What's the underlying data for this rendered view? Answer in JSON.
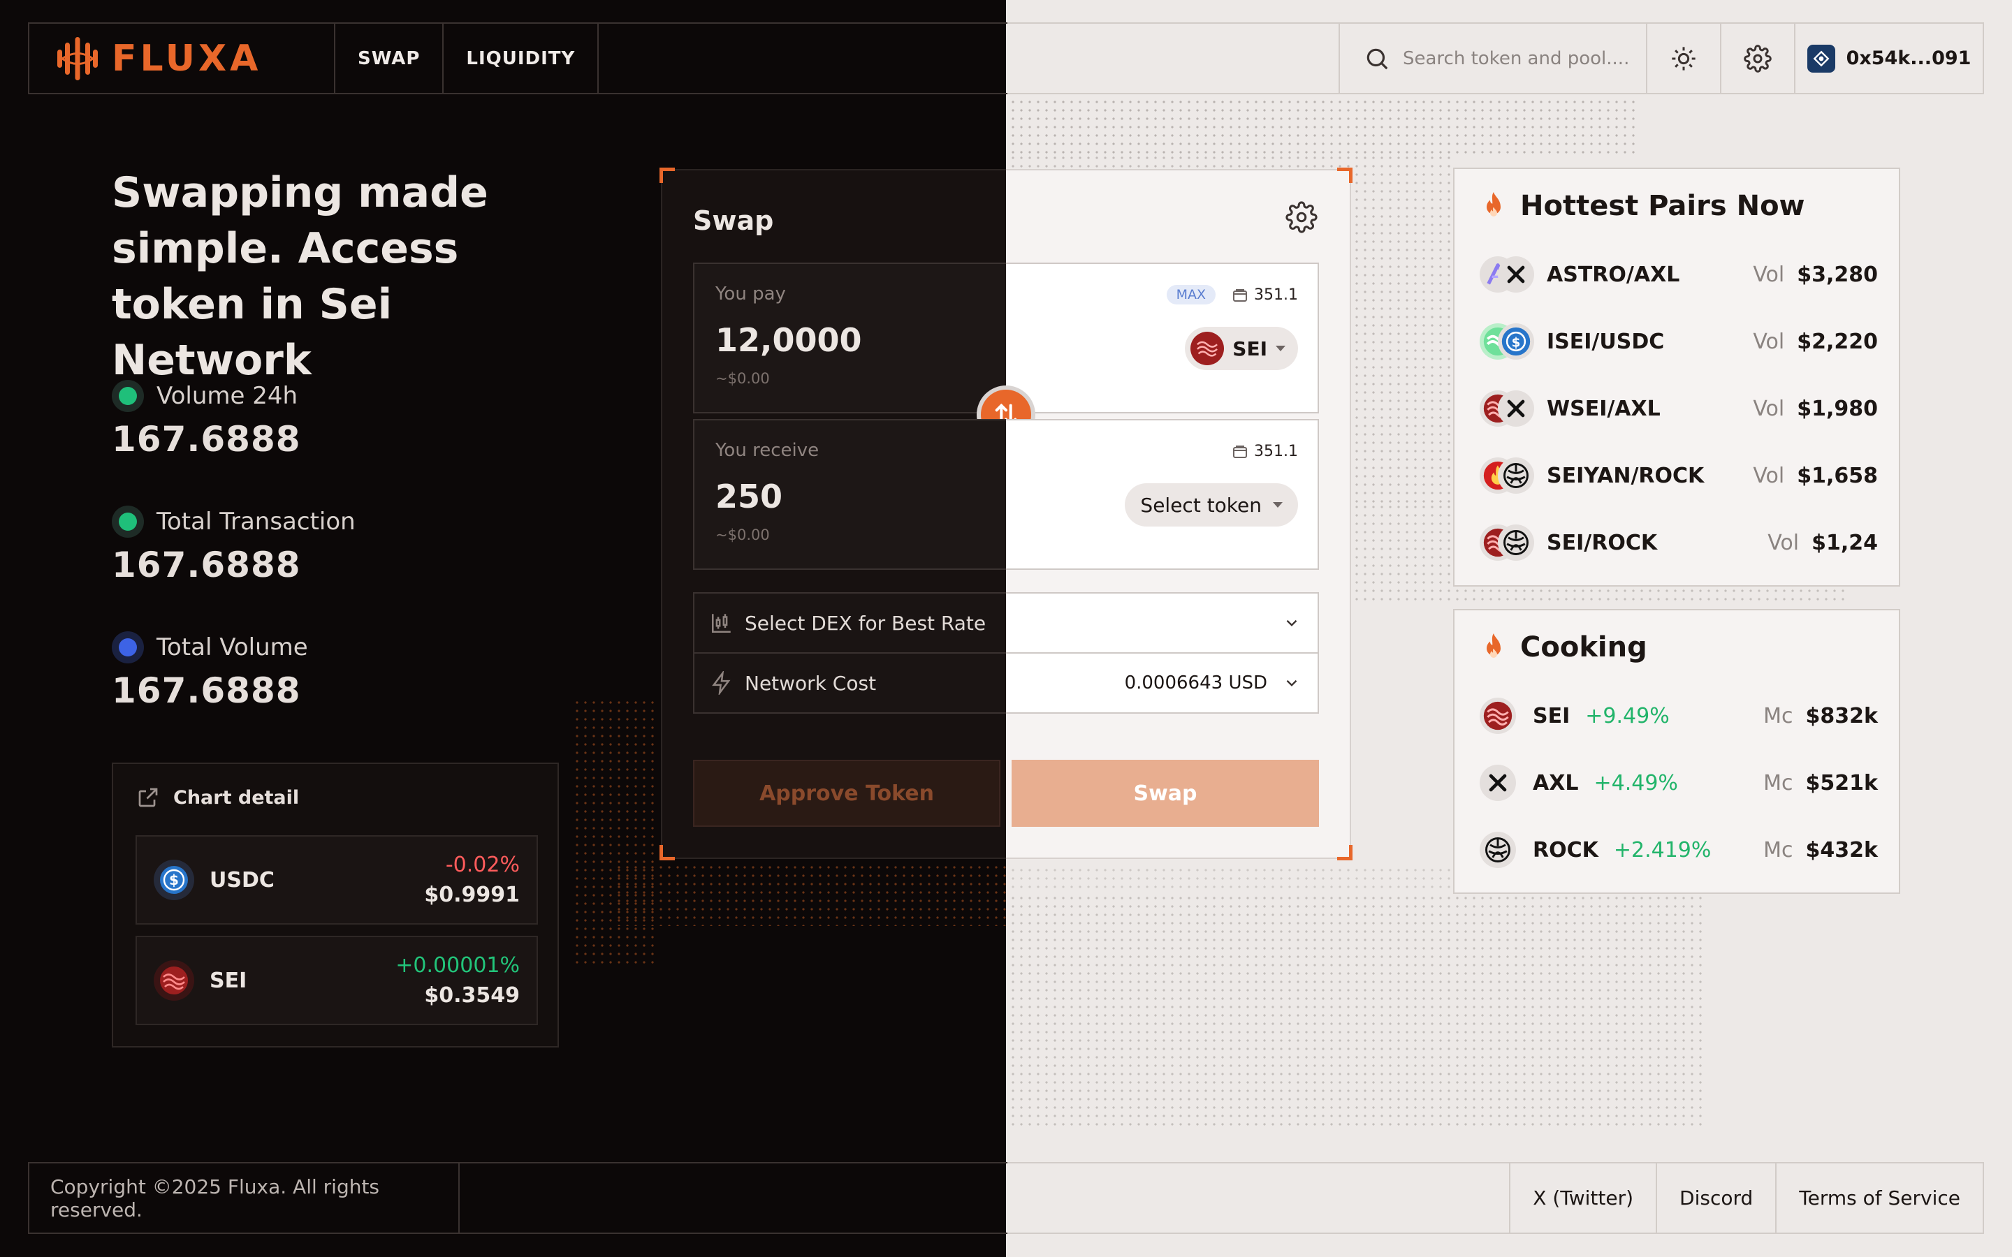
{
  "header": {
    "logo_text": "FLUXA",
    "nav": [
      "SWAP",
      "LIQUIDITY"
    ],
    "search_placeholder": "Search token and pool....",
    "wallet_address": "0x54k...091"
  },
  "hero": {
    "title": "Swapping made simple. Access token in Sei Network",
    "stats": [
      {
        "label": "Volume 24h",
        "value": "167.6888",
        "color": "#1fbf7a"
      },
      {
        "label": "Total Transaction",
        "value": "167.6888",
        "color": "#1fbf7a"
      },
      {
        "label": "Total Volume",
        "value": "167.6888",
        "color": "#3d63e6"
      }
    ]
  },
  "chart_detail": {
    "title": "Chart detail",
    "rows": [
      {
        "name": "USDC",
        "change": "-0.02%",
        "price": "$0.9991",
        "change_color": "#ff5c5c"
      },
      {
        "name": "SEI",
        "change": "+0.00001%",
        "price": "$0.3549",
        "change_color": "#22c47a"
      }
    ]
  },
  "swap": {
    "title": "Swap",
    "pay": {
      "label": "You pay",
      "amount": "12,0000",
      "usd": "~$0.00",
      "max": "MAX",
      "balance": "351.1",
      "token": "SEI"
    },
    "receive": {
      "label": "You receive",
      "amount": "250",
      "usd": "~$0.00",
      "balance": "351.1",
      "select": "Select token"
    },
    "dex_label": "Select DEX for Best Rate",
    "network_cost_label": "Network Cost",
    "network_cost_value": "0.0006643 USD",
    "approve_label": "Approve Token",
    "swap_label": "Swap"
  },
  "hottest": {
    "title": "Hottest Pairs Now",
    "vol_label": "Vol",
    "pairs": [
      {
        "name": "ASTRO/AXL",
        "vol": "$3,280"
      },
      {
        "name": "ISEI/USDC",
        "vol": "$2,220"
      },
      {
        "name": "WSEI/AXL",
        "vol": "$1,980"
      },
      {
        "name": "SEIYAN/ROCK",
        "vol": "$1,658"
      },
      {
        "name": "SEI/ROCK",
        "vol": "$1,24"
      }
    ]
  },
  "cooking": {
    "title": "Cooking",
    "mc_label": "Mc",
    "items": [
      {
        "name": "SEI",
        "change": "+9.49%",
        "mc": "$832k"
      },
      {
        "name": "AXL",
        "change": "+4.49%",
        "mc": "$521k"
      },
      {
        "name": "ROCK",
        "change": "+2.419%",
        "mc": "$432k"
      }
    ]
  },
  "footer": {
    "copyright": "Copyright ©2025 Fluxa. All rights reserved.",
    "links": [
      "X (Twitter)",
      "Discord",
      "Terms of Service"
    ]
  }
}
